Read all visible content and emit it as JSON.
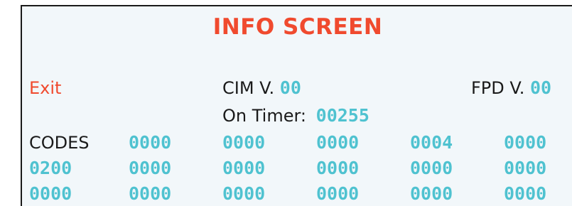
{
  "screen": {
    "title": "INFO SCREEN",
    "exit_label": "Exit",
    "cim_label": "CIM V.",
    "cim_value": "00",
    "fpd_label": "FPD V.",
    "fpd_value": "00",
    "timer_label": "On Timer:",
    "timer_value": "00255"
  },
  "codes": {
    "label": "CODES",
    "rows": [
      [
        "0000",
        "0000",
        "0000",
        "0004",
        "0000"
      ],
      [
        "0200",
        "0000",
        "0000",
        "0000",
        "0000",
        "0000"
      ],
      [
        "0000",
        "0000",
        "0000",
        "0000",
        "0000",
        "0000"
      ]
    ]
  },
  "colors": {
    "title": "#f04a2e",
    "exit": "#f04a2e",
    "value": "#4fc2d0",
    "text": "#1a1a1a",
    "background": "#f2f7fa"
  }
}
